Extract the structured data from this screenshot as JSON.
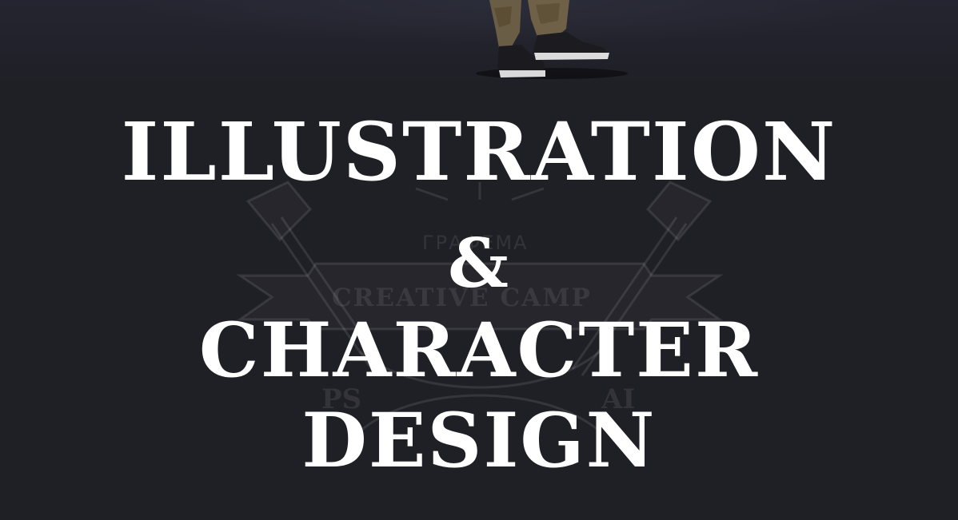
{
  "headline": {
    "line1": "ILLUSTRATION",
    "line2": "&",
    "line3": "CHARACTER",
    "line4": "DESIGN"
  },
  "emblem": {
    "top_text": "ГРАФЕМА",
    "band_text": "CREATIVE CAMP",
    "left_text": "PS",
    "right_text": "AI"
  },
  "colors": {
    "background": "#1f1f26",
    "headline": "#ffffff"
  }
}
